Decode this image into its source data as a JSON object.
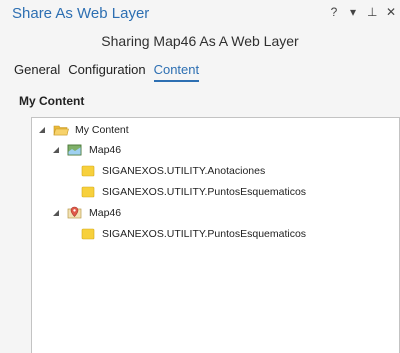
{
  "pane": {
    "title": "Share As Web Layer",
    "controls": {
      "help": "?",
      "options": "▾",
      "pin": "⊥",
      "close": "✕"
    }
  },
  "subtitle": "Sharing Map46 As A Web Layer",
  "tabs": [
    {
      "label": "General",
      "active": false
    },
    {
      "label": "Configuration",
      "active": false
    },
    {
      "label": "Content",
      "active": true
    }
  ],
  "section_title": "My Content",
  "tree": {
    "root": {
      "label": "My Content",
      "icon": "folder-icon",
      "expanded": true
    },
    "maps": [
      {
        "label": "Map46",
        "icon": "map-icon",
        "expanded": true,
        "children": [
          {
            "label": "SIGANEXOS.UTILITY.Anotaciones",
            "icon": "layer-icon"
          },
          {
            "label": "SIGANEXOS.UTILITY.PuntosEsquematicos",
            "icon": "layer-icon"
          }
        ]
      },
      {
        "label": "Map46",
        "icon": "map-pin-icon",
        "expanded": true,
        "children": [
          {
            "label": "SIGANEXOS.UTILITY.PuntosEsquematicos",
            "icon": "layer-icon"
          }
        ]
      }
    ]
  },
  "colors": {
    "accent": "#2d6fb2",
    "background": "#f5f5f5",
    "folder": "#f2c94c",
    "layer": "#f7d03c"
  }
}
